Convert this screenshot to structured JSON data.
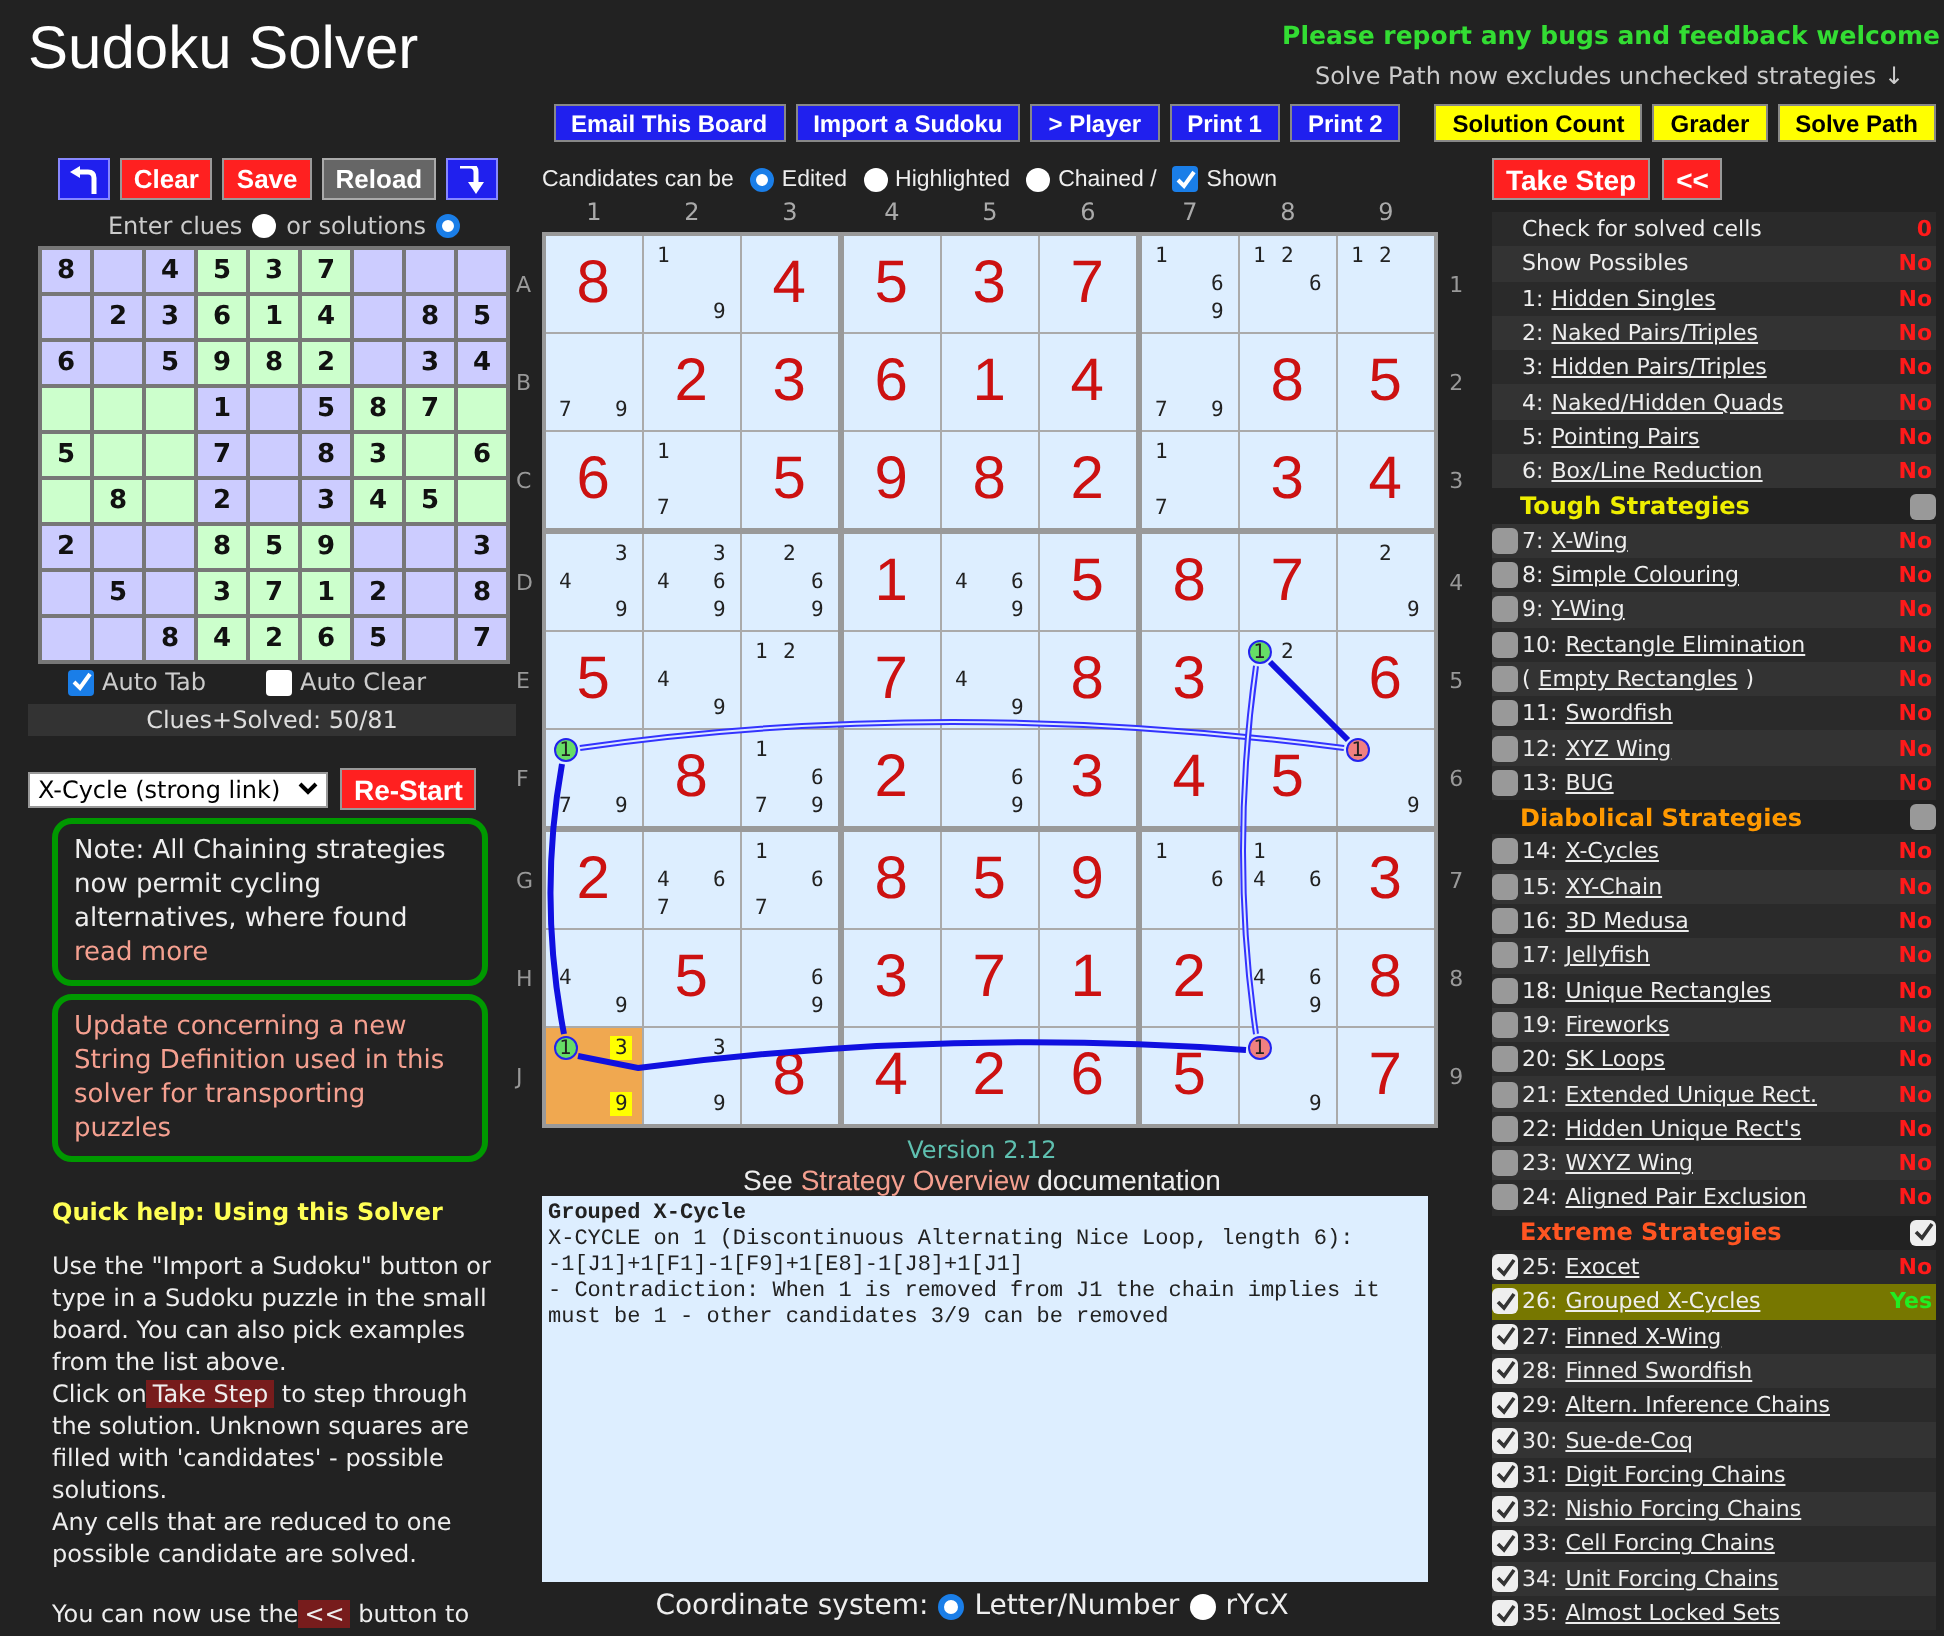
{
  "header": {
    "title": "Sudoku Solver",
    "notice": "Please report any bugs and feedback welcome",
    "subnotice": "Solve Path now excludes unchecked strategies ↓"
  },
  "toolbar": [
    {
      "label": "Email This Board",
      "kind": "blue"
    },
    {
      "label": "Import a Sudoku",
      "kind": "blue"
    },
    {
      "label": "> Player",
      "kind": "blue"
    },
    {
      "label": "Print 1",
      "kind": "blue"
    },
    {
      "label": "Print 2",
      "kind": "blue"
    },
    {
      "label": "Solution Count",
      "kind": "yellow"
    },
    {
      "label": "Grader",
      "kind": "yellow"
    },
    {
      "label": "Solve Path",
      "kind": "yellow"
    }
  ],
  "editor": {
    "buttons": [
      {
        "kind": "undo"
      },
      {
        "kind": "red",
        "label": "Clear"
      },
      {
        "kind": "red",
        "label": "Save"
      },
      {
        "kind": "grey",
        "label": "Reload"
      },
      {
        "kind": "redo"
      }
    ],
    "entry_modes": [
      {
        "label": "Enter clues",
        "selected": false
      },
      {
        "label": "or solutions",
        "selected": true
      }
    ],
    "board": [
      [
        {
          "value": "8"
        },
        {
          "blank": true
        },
        {
          "value": "4"
        },
        {
          "value": "5"
        },
        {
          "value": "3"
        },
        {
          "value": "7"
        },
        {
          "blank": true
        },
        {
          "blank": true
        },
        {
          "blank": true
        }
      ],
      [
        {
          "blank": true
        },
        {
          "value": "2"
        },
        {
          "value": "3"
        },
        {
          "value": "6"
        },
        {
          "value": "1"
        },
        {
          "value": "4"
        },
        {
          "blank": true
        },
        {
          "value": "8"
        },
        {
          "value": "5"
        }
      ],
      [
        {
          "value": "6"
        },
        {
          "blank": true
        },
        {
          "value": "5"
        },
        {
          "value": "9"
        },
        {
          "value": "8"
        },
        {
          "value": "2"
        },
        {
          "blank": true
        },
        {
          "value": "3"
        },
        {
          "value": "4"
        }
      ],
      [
        {
          "blank": true
        },
        {
          "blank": true
        },
        {
          "blank": true
        },
        {
          "value": "1"
        },
        {
          "blank": true
        },
        {
          "value": "5"
        },
        {
          "value": "8"
        },
        {
          "value": "7"
        },
        {
          "blank": true
        }
      ],
      [
        {
          "value": "5"
        },
        {
          "blank": true
        },
        {
          "blank": true
        },
        {
          "value": "7"
        },
        {
          "blank": true
        },
        {
          "value": "8"
        },
        {
          "value": "3"
        },
        {
          "blank": true
        },
        {
          "value": "6"
        }
      ],
      [
        {
          "blank": true
        },
        {
          "value": "8"
        },
        {
          "blank": true
        },
        {
          "value": "2"
        },
        {
          "blank": true
        },
        {
          "value": "3"
        },
        {
          "value": "4"
        },
        {
          "value": "5"
        },
        {
          "blank": true
        }
      ],
      [
        {
          "value": "2"
        },
        {
          "blank": true
        },
        {
          "blank": true
        },
        {
          "value": "8"
        },
        {
          "value": "5"
        },
        {
          "value": "9"
        },
        {
          "blank": true
        },
        {
          "blank": true
        },
        {
          "value": "3"
        }
      ],
      [
        {
          "blank": true
        },
        {
          "value": "5"
        },
        {
          "blank": true
        },
        {
          "value": "3"
        },
        {
          "value": "7"
        },
        {
          "value": "1"
        },
        {
          "value": "2"
        },
        {
          "blank": true
        },
        {
          "value": "8"
        }
      ],
      [
        {
          "blank": true
        },
        {
          "blank": true
        },
        {
          "value": "8"
        },
        {
          "value": "4"
        },
        {
          "value": "2"
        },
        {
          "value": "6"
        },
        {
          "value": "5"
        },
        {
          "blank": true
        },
        {
          "value": "7"
        }
      ]
    ],
    "options": [
      {
        "label": "Auto Tab",
        "checked": true
      },
      {
        "label": "Auto Clear",
        "checked": false
      }
    ],
    "counter": "Clues+Solved: 50/81",
    "example": "X-Cycle (strong link)",
    "restart": "Re-Start"
  },
  "notes": [
    {
      "kind": "text",
      "text": "Note: All Chaining strategies now permit cycling alternatives, where found",
      "link": "read more"
    },
    {
      "kind": "link",
      "text": "Update concerning a new String Definition used in this solver for transporting puzzles"
    }
  ],
  "help": {
    "title": "Quick help: Using this Solver",
    "paragraphs": [
      {
        "text": "Use the \"Import a Sudoku\" button or type in a Sudoku puzzle in the small board. You can also pick examples from the list above."
      },
      {
        "text": "Click on",
        "badge": "Take Step",
        "after": "to step through the solution. Unknown squares are filled with 'candidates' - possible solutions."
      },
      {
        "text": "Any cells that are reduced to one possible candidate are solved."
      },
      {
        "text": "You can now use the",
        "badge": "<<",
        "after": "button to"
      }
    ]
  },
  "candidate_bar": {
    "label": "Candidates can be",
    "modes": [
      {
        "label": "Edited",
        "selected": true
      },
      {
        "label": "Highlighted",
        "selected": false
      },
      {
        "label": "Chained /",
        "selected": false
      }
    ],
    "shown": {
      "label": "Shown",
      "checked": true
    }
  },
  "columns": [
    "1",
    "2",
    "3",
    "4",
    "5",
    "6",
    "7",
    "8",
    "9"
  ],
  "rows": [
    {
      "letter": "A",
      "number": "1",
      "cells": [
        {
          "value": "8"
        },
        {
          "candidates": [
            "1",
            "9"
          ]
        },
        {
          "value": "4"
        },
        {
          "value": "5"
        },
        {
          "value": "3"
        },
        {
          "value": "7"
        },
        {
          "candidates": [
            "1",
            "6",
            "9"
          ]
        },
        {
          "candidates": [
            "1",
            "2",
            "6"
          ]
        },
        {
          "candidates": [
            "1",
            "2"
          ]
        }
      ]
    },
    {
      "letter": "B",
      "number": "2",
      "cells": [
        {
          "candidates": [
            "7",
            "9"
          ]
        },
        {
          "value": "2"
        },
        {
          "value": "3"
        },
        {
          "value": "6"
        },
        {
          "value": "1"
        },
        {
          "value": "4"
        },
        {
          "candidates": [
            "7",
            "9"
          ]
        },
        {
          "value": "8"
        },
        {
          "value": "5"
        }
      ]
    },
    {
      "letter": "C",
      "number": "3",
      "cells": [
        {
          "value": "6"
        },
        {
          "candidates": [
            "1",
            "7"
          ]
        },
        {
          "value": "5"
        },
        {
          "value": "9"
        },
        {
          "value": "8"
        },
        {
          "value": "2"
        },
        {
          "candidates": [
            "1",
            "7"
          ]
        },
        {
          "value": "3"
        },
        {
          "value": "4"
        }
      ]
    },
    {
      "letter": "D",
      "number": "4",
      "cells": [
        {
          "candidates": [
            "3",
            "4",
            "9"
          ]
        },
        {
          "candidates": [
            "3",
            "4",
            "6",
            "9"
          ]
        },
        {
          "candidates": [
            "2",
            "6",
            "9"
          ]
        },
        {
          "value": "1"
        },
        {
          "candidates": [
            "4",
            "6",
            "9"
          ]
        },
        {
          "value": "5"
        },
        {
          "value": "8"
        },
        {
          "value": "7"
        },
        {
          "candidates": [
            "2",
            "9"
          ]
        }
      ]
    },
    {
      "letter": "E",
      "number": "5",
      "cells": [
        {
          "value": "5"
        },
        {
          "candidates": [
            "4",
            "9"
          ]
        },
        {
          "candidates": [
            "1",
            "2"
          ]
        },
        {
          "value": "7"
        },
        {
          "candidates": [
            "4",
            "9"
          ]
        },
        {
          "value": "8"
        },
        {
          "value": "3"
        },
        {
          "candidates": [
            {
              "kind": "node",
              "digit": "1",
              "color": "#66dd66"
            },
            "2"
          ]
        },
        {
          "value": "6"
        }
      ]
    },
    {
      "letter": "F",
      "number": "6",
      "cells": [
        {
          "candidates": [
            {
              "kind": "node",
              "digit": "1",
              "color": "#66dd66"
            },
            "7",
            "9"
          ]
        },
        {
          "value": "8"
        },
        {
          "candidates": [
            "1",
            "6",
            "7",
            "9"
          ]
        },
        {
          "value": "2"
        },
        {
          "candidates": [
            "6",
            "9"
          ]
        },
        {
          "value": "3"
        },
        {
          "value": "4"
        },
        {
          "value": "5"
        },
        {
          "candidates": [
            {
              "kind": "node",
              "digit": "1",
              "color": "#f08080"
            },
            "9"
          ]
        }
      ]
    },
    {
      "letter": "G",
      "number": "7",
      "cells": [
        {
          "value": "2"
        },
        {
          "candidates": [
            "4",
            "6",
            "7"
          ]
        },
        {
          "candidates": [
            "1",
            "6",
            "7"
          ]
        },
        {
          "value": "8"
        },
        {
          "value": "5"
        },
        {
          "value": "9"
        },
        {
          "candidates": [
            "1",
            "6"
          ]
        },
        {
          "candidates": [
            "1",
            "4",
            "6"
          ]
        },
        {
          "value": "3"
        }
      ]
    },
    {
      "letter": "H",
      "number": "8",
      "cells": [
        {
          "candidates": [
            "4",
            "9"
          ]
        },
        {
          "value": "5"
        },
        {
          "candidates": [
            "6",
            "9"
          ]
        },
        {
          "value": "3"
        },
        {
          "value": "7"
        },
        {
          "value": "1"
        },
        {
          "value": "2"
        },
        {
          "candidates": [
            "4",
            "6",
            "9"
          ]
        },
        {
          "value": "8"
        }
      ]
    },
    {
      "letter": "J",
      "number": "9",
      "cells": [
        {
          "color": "#f0a850",
          "candidates": [
            {
              "kind": "node",
              "digit": "1",
              "color": "#66dd66"
            },
            {
              "kind": "mark",
              "digit": "3",
              "color": "#ffff00"
            },
            {
              "kind": "mark",
              "digit": "9",
              "color": "#ffff00"
            }
          ]
        },
        {
          "candidates": [
            "3",
            "9"
          ]
        },
        {
          "value": "8"
        },
        {
          "value": "4"
        },
        {
          "value": "2"
        },
        {
          "value": "6"
        },
        {
          "value": "5"
        },
        {
          "candidates": [
            {
              "kind": "node",
              "digit": "1",
              "color": "#f08080"
            },
            "9"
          ]
        },
        {
          "value": "7"
        }
      ]
    }
  ],
  "version": "Version 2.12",
  "documentation": {
    "before": "See",
    "link": "Strategy Overview",
    "after": "documentation"
  },
  "log": {
    "title": "Grouped X-Cycle",
    "lines": [
      "X-CYCLE on 1 (Discontinuous Alternating Nice Loop, length 6):",
      "-1[J1]+1[F1]-1[F9]+1[E8]-1[J8]+1[J1]",
      "- Contradiction: When 1 is removed from J1 the chain implies it must be 1 - other candidates 3/9 can be removed"
    ]
  },
  "coordinates": {
    "label": "Coordinate system:",
    "options": [
      {
        "label": "Letter/Number",
        "selected": true
      },
      {
        "label": "rYcX",
        "selected": false
      }
    ]
  },
  "step_buttons": [
    "Take Step",
    "<<"
  ],
  "strategies": [
    {
      "kind": "setting",
      "name": "Check for solved cells",
      "status": "0",
      "found": false
    },
    {
      "kind": "setting",
      "name": "Show Possibles",
      "status": "No",
      "found": false
    },
    {
      "kind": "basic",
      "prefix": "1:",
      "name": "Hidden Singles",
      "status": "No",
      "found": false
    },
    {
      "kind": "basic",
      "prefix": "2:",
      "name": "Naked Pairs/Triples",
      "status": "No",
      "found": false
    },
    {
      "kind": "basic",
      "prefix": "3:",
      "name": "Hidden Pairs/Triples",
      "status": "No",
      "found": false
    },
    {
      "kind": "basic",
      "prefix": "4:",
      "name": "Naked/Hidden Quads",
      "status": "No",
      "found": false
    },
    {
      "kind": "basic",
      "prefix": "5:",
      "name": "Pointing Pairs",
      "status": "No",
      "found": false
    },
    {
      "kind": "basic",
      "prefix": "6:",
      "name": "Box/Line Reduction",
      "status": "No",
      "found": false
    },
    {
      "kind": "header",
      "name": "Tough Strategies",
      "color": "#eeee00",
      "checked": false
    },
    {
      "kind": "check",
      "prefix": "7:",
      "name": "X-Wing",
      "status": "No",
      "checked": false,
      "found": false
    },
    {
      "kind": "check",
      "prefix": "8:",
      "name": "Simple Colouring",
      "status": "No",
      "checked": false,
      "found": false
    },
    {
      "kind": "check",
      "prefix": "9:",
      "name": "Y-Wing",
      "status": "No",
      "checked": false,
      "found": false
    },
    {
      "kind": "check",
      "prefix": "10:",
      "name": "Rectangle Elimination",
      "status": "No",
      "checked": false,
      "found": false
    },
    {
      "kind": "check",
      "prefix": "(",
      "name": "Empty Rectangles",
      "suffix": ")",
      "status": "No",
      "checked": false,
      "found": false
    },
    {
      "kind": "check",
      "prefix": "11:",
      "name": "Swordfish",
      "status": "No",
      "checked": false,
      "found": false
    },
    {
      "kind": "check",
      "prefix": "12:",
      "name": "XYZ Wing",
      "status": "No",
      "checked": false,
      "found": false
    },
    {
      "kind": "check",
      "prefix": "13:",
      "name": "BUG",
      "status": "No",
      "checked": false,
      "found": false
    },
    {
      "kind": "header",
      "name": "Diabolical Strategies",
      "color": "#ff9900",
      "checked": false
    },
    {
      "kind": "check",
      "prefix": "14:",
      "name": "X-Cycles",
      "status": "No",
      "checked": false,
      "found": false
    },
    {
      "kind": "check",
      "prefix": "15:",
      "name": "XY-Chain",
      "status": "No",
      "checked": false,
      "found": false
    },
    {
      "kind": "check",
      "prefix": "16:",
      "name": "3D Medusa",
      "status": "No",
      "checked": false,
      "found": false
    },
    {
      "kind": "check",
      "prefix": "17:",
      "name": "Jellyfish",
      "status": "No",
      "checked": false,
      "found": false
    },
    {
      "kind": "check",
      "prefix": "18:",
      "name": "Unique Rectangles",
      "status": "No",
      "checked": false,
      "found": false
    },
    {
      "kind": "check",
      "prefix": "19:",
      "name": "Fireworks",
      "status": "No",
      "checked": false,
      "found": false
    },
    {
      "kind": "check",
      "prefix": "20:",
      "name": "SK Loops",
      "status": "No",
      "checked": false,
      "found": false
    },
    {
      "kind": "check",
      "prefix": "21:",
      "name": "Extended Unique Rect.",
      "status": "No",
      "checked": false,
      "found": false
    },
    {
      "kind": "check",
      "prefix": "22:",
      "name": "Hidden Unique Rect's",
      "status": "No",
      "checked": false,
      "found": false
    },
    {
      "kind": "check",
      "prefix": "23:",
      "name": "WXYZ Wing",
      "status": "No",
      "checked": false,
      "found": false
    },
    {
      "kind": "check",
      "prefix": "24:",
      "name": "Aligned Pair Exclusion",
      "status": "No",
      "checked": false,
      "found": false
    },
    {
      "kind": "header",
      "name": "Extreme Strategies",
      "color": "#ff5522",
      "checked": true
    },
    {
      "kind": "check",
      "prefix": "25:",
      "name": "Exocet",
      "status": "No",
      "checked": true,
      "found": false
    },
    {
      "kind": "check",
      "prefix": "26:",
      "name": "Grouped X-Cycles",
      "status": "Yes",
      "checked": true,
      "found": true
    },
    {
      "kind": "check",
      "prefix": "27:",
      "name": "Finned X-Wing",
      "checked": true,
      "found": false
    },
    {
      "kind": "check",
      "prefix": "28:",
      "name": "Finned Swordfish",
      "checked": true,
      "found": false
    },
    {
      "kind": "check",
      "prefix": "29:",
      "name": "Altern. Inference Chains",
      "checked": true,
      "found": false
    },
    {
      "kind": "check",
      "prefix": "30:",
      "name": "Sue-de-Coq",
      "checked": true,
      "found": false
    },
    {
      "kind": "check",
      "prefix": "31:",
      "name": "Digit Forcing Chains",
      "checked": true,
      "found": false
    },
    {
      "kind": "check",
      "prefix": "32:",
      "name": "Nishio Forcing Chains",
      "checked": true,
      "found": false
    },
    {
      "kind": "check",
      "prefix": "33:",
      "name": "Cell Forcing Chains",
      "checked": true,
      "found": false
    },
    {
      "kind": "check",
      "prefix": "34:",
      "name": "Unit Forcing Chains",
      "checked": true,
      "found": false
    },
    {
      "kind": "check",
      "prefix": "35:",
      "name": "Almost Locked Sets",
      "checked": true,
      "found": false
    }
  ]
}
